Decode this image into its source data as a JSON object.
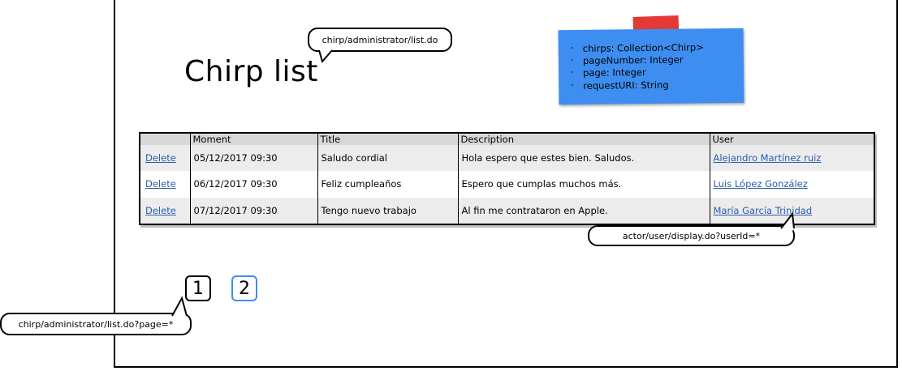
{
  "page": {
    "title": "Chirp list"
  },
  "annotations": {
    "list_url": "chirp/administrator/list.do",
    "user_url": "actor/user/display.do?userId=*",
    "page_url": "chirp/administrator/list.do?page=*"
  },
  "model_note": {
    "items": [
      "chirps: Collection<Chirp>",
      "pageNumber: Integer",
      "page: Integer",
      "requestURI: String"
    ],
    "note_color": "#3d8ef0",
    "tape_color": "#e53935"
  },
  "table": {
    "headers": [
      "",
      "Moment",
      "Title",
      "Description",
      "User"
    ],
    "rows": [
      {
        "action": "Delete",
        "moment": "05/12/2017 09:30",
        "title": "Saludo cordial",
        "description": "Hola espero que estes bien. Saludos.",
        "user": "Alejandro Martínez ruiz"
      },
      {
        "action": "Delete",
        "moment": "06/12/2017 09:30",
        "title": "Feliz cumpleaños",
        "description": "Espero que cumplas muchos más.",
        "user": "Luis López González"
      },
      {
        "action": "Delete",
        "moment": "07/12/2017 09:30",
        "title": "Tengo nuevo trabajo",
        "description": "Al fin me contrataron en Apple.",
        "user": "María García Trinidad"
      }
    ],
    "link_color": "#2a5db0"
  },
  "pagination": {
    "pages": [
      "1",
      "2"
    ],
    "current_color": "#3d8ef0"
  }
}
